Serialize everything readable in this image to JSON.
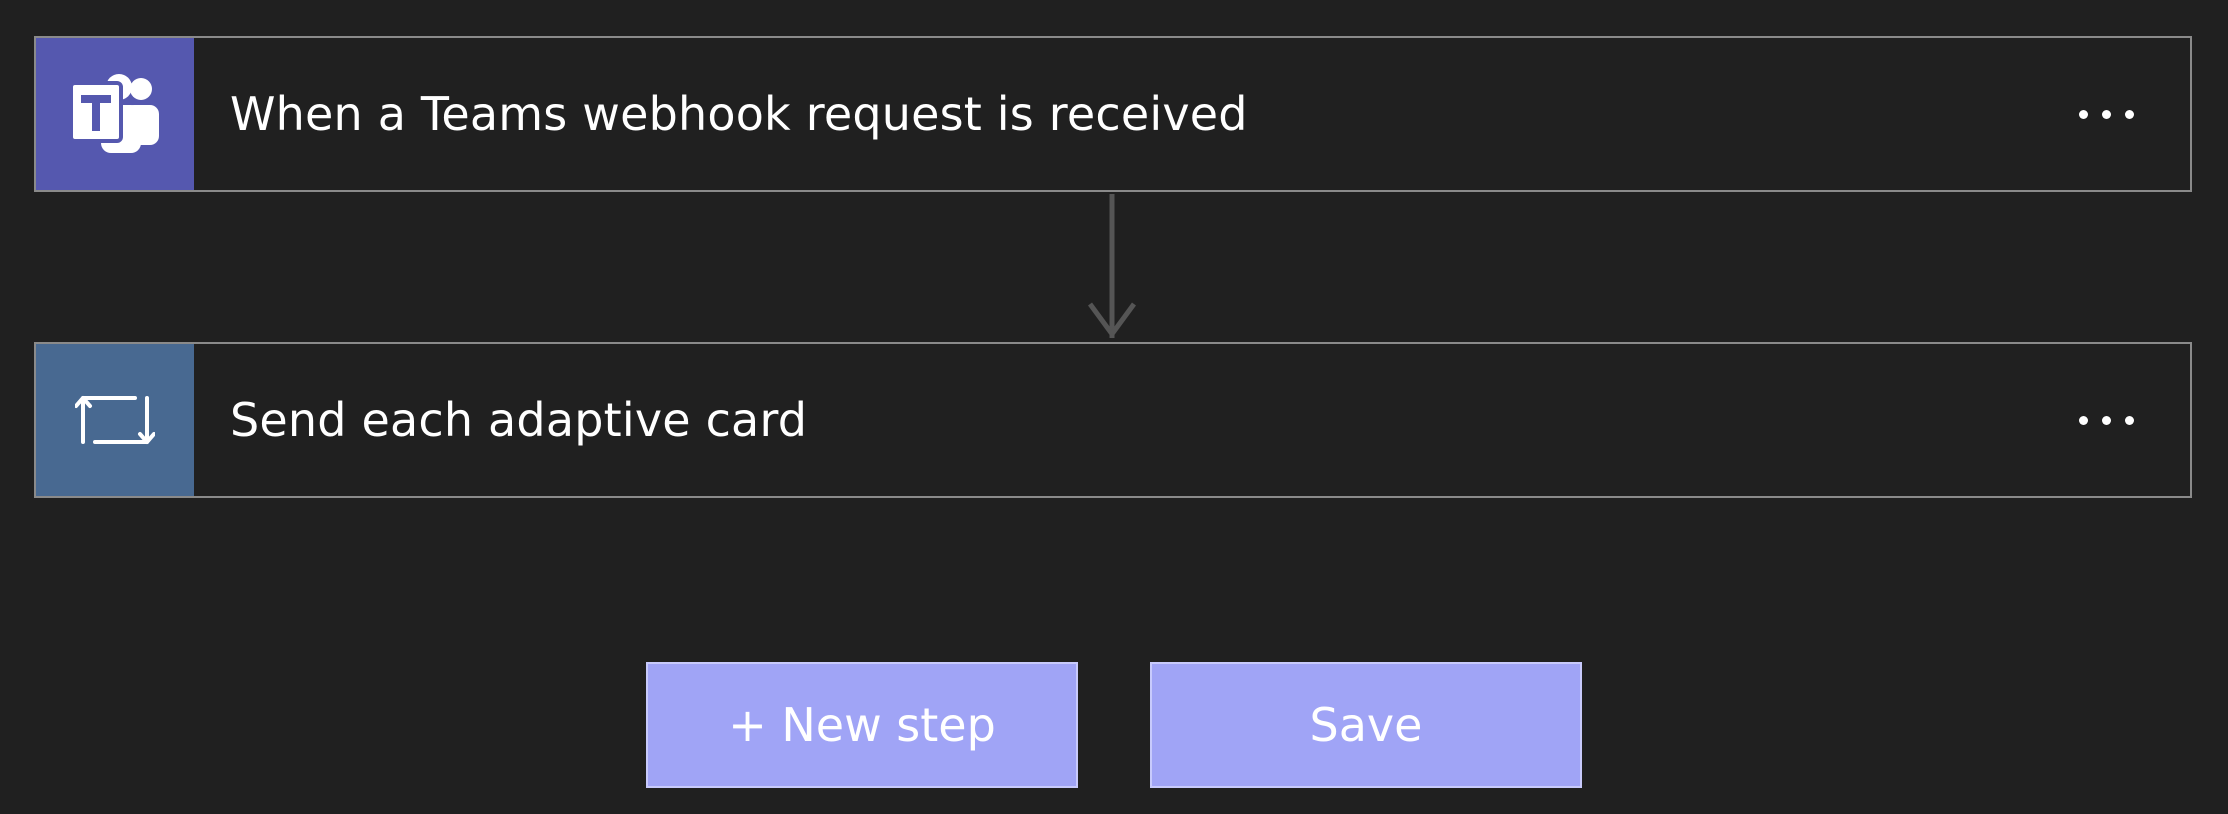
{
  "steps": [
    {
      "title": "When a Teams webhook request is received",
      "icon": "teams-icon",
      "icon_bg": "#5558af"
    },
    {
      "title": "Send each adaptive card",
      "icon": "loop-icon",
      "icon_bg": "#486991"
    }
  ],
  "footer": {
    "new_step_label": "+ New step",
    "save_label": "Save"
  },
  "colors": {
    "background": "#202020",
    "card_border": "#8a8a8a",
    "button_bg": "#a0a4f6",
    "connector": "#555555"
  }
}
